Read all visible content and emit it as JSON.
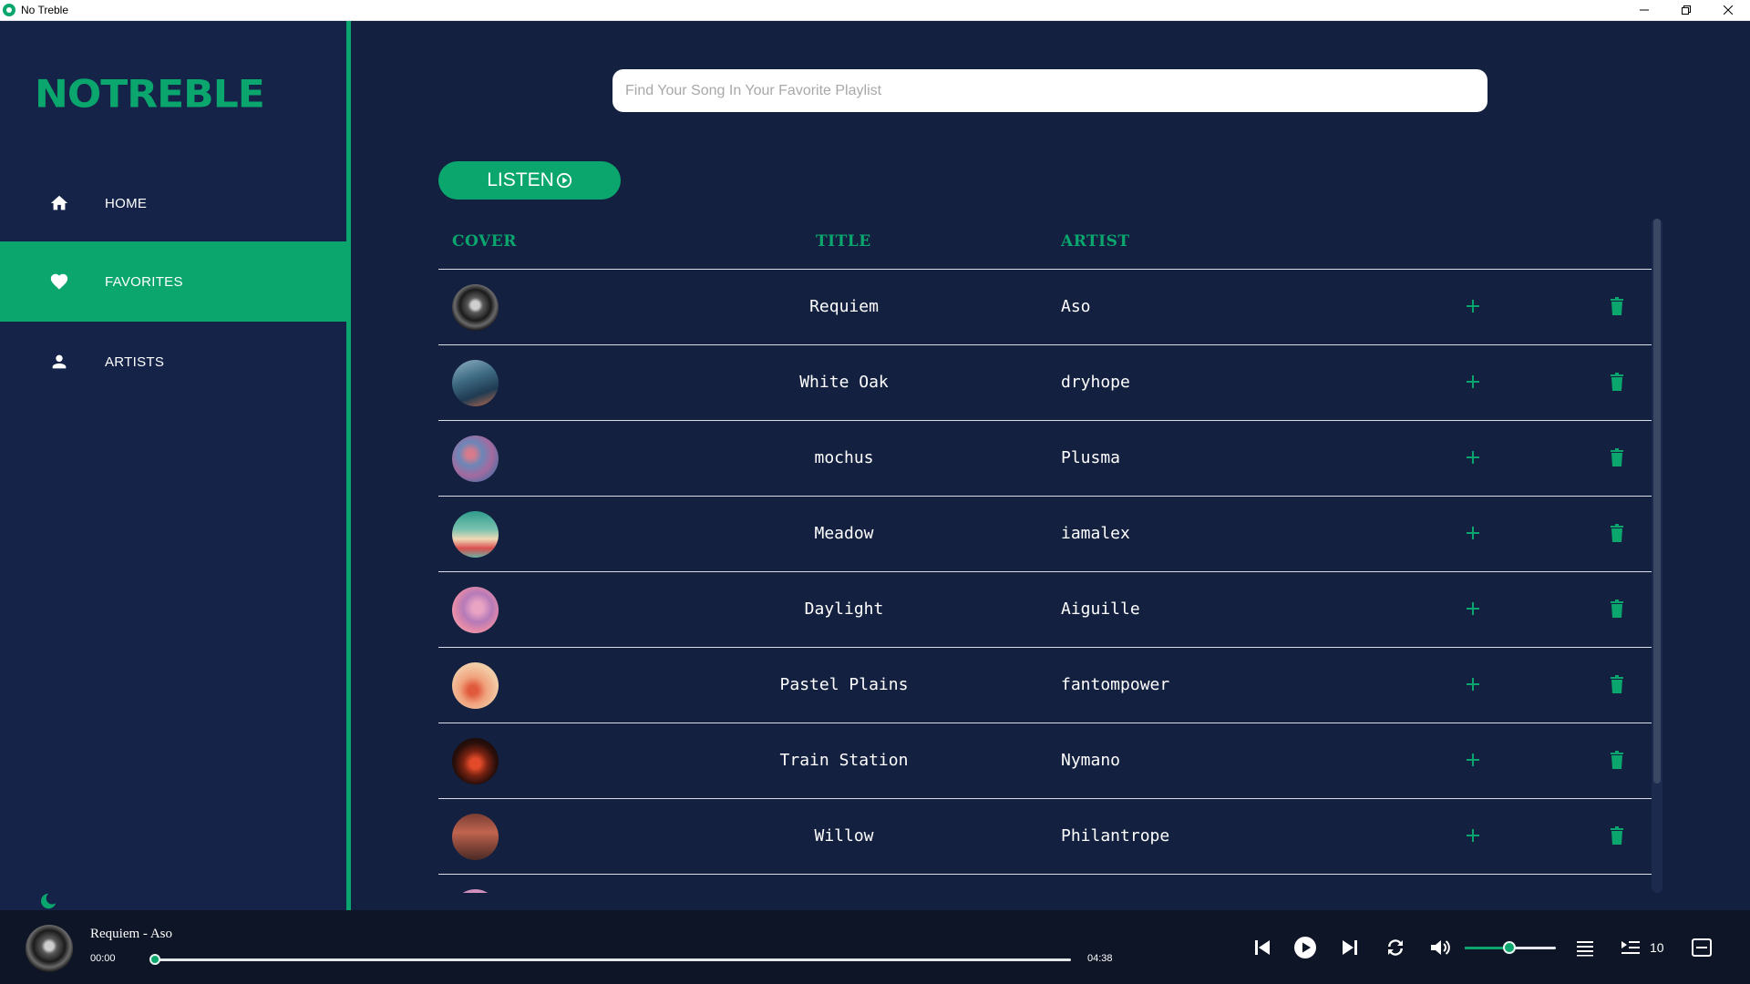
{
  "window": {
    "title": "No Treble"
  },
  "sidebar": {
    "logo": "NOTREBLE",
    "items": [
      {
        "label": "HOME",
        "icon": "home-icon",
        "active": false
      },
      {
        "label": "FAVORITES",
        "icon": "heart-icon",
        "active": true
      },
      {
        "label": "ARTISTS",
        "icon": "person-icon",
        "active": false
      }
    ],
    "theme_toggle_icon": "moon-icon"
  },
  "search": {
    "placeholder": "Find Your Song In Your Favorite Playlist",
    "value": ""
  },
  "listen_button": {
    "label": "LISTEN"
  },
  "table": {
    "headers": {
      "cover": "COVER",
      "title": "TITLE",
      "artist": "ARTIST"
    },
    "rows": [
      {
        "title": "Requiem",
        "artist": "Aso"
      },
      {
        "title": "White Oak",
        "artist": "dryhope"
      },
      {
        "title": "mochus",
        "artist": "Plusma"
      },
      {
        "title": "Meadow",
        "artist": "iamalex"
      },
      {
        "title": "Daylight",
        "artist": "Aiguille"
      },
      {
        "title": "Pastel Plains",
        "artist": "fantompower"
      },
      {
        "title": "Train Station",
        "artist": "Nymano"
      },
      {
        "title": "Willow",
        "artist": "Philantrope"
      }
    ]
  },
  "player": {
    "now_playing": "Requiem - Aso",
    "current_time": "00:00",
    "total_time": "04:38",
    "progress": 0,
    "volume": 0.5,
    "queue_count": "10"
  },
  "colors": {
    "accent": "#0aa66d",
    "background": "#132040",
    "sidebar": "#142347",
    "player_bar": "#0e1526"
  }
}
